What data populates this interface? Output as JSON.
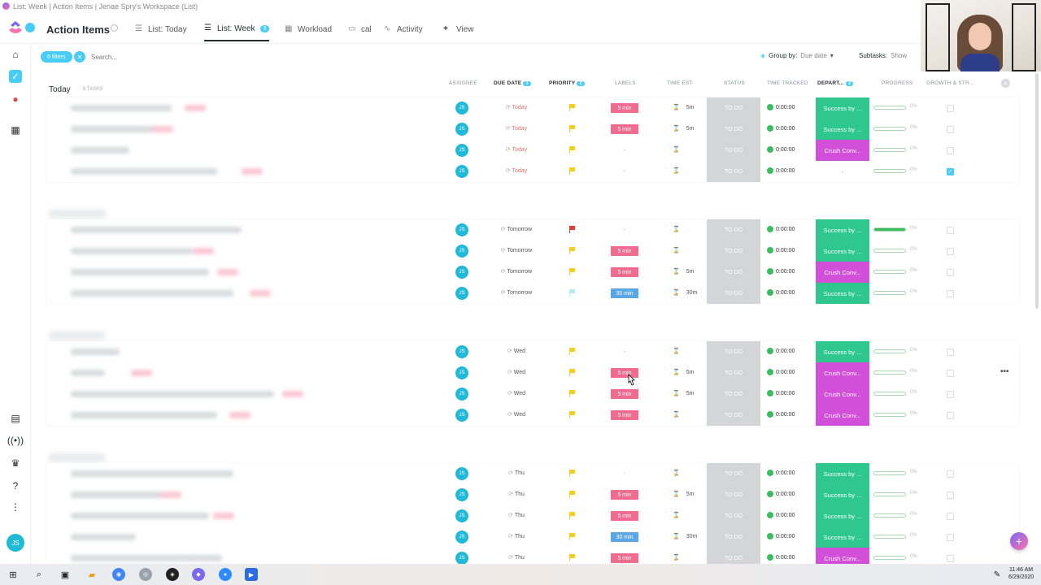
{
  "window_title": "List: Week | Action Items | Jenae Spry's Workspace (List)",
  "header": {
    "space_title": "Action Items",
    "tabs": [
      {
        "label": "List: Today",
        "icon": "list-icon"
      },
      {
        "label": "List: Week",
        "icon": "list-icon",
        "badge": "3"
      },
      {
        "label": "Workload",
        "icon": "grid-icon"
      },
      {
        "label": "cal",
        "icon": "calendar-icon"
      },
      {
        "label": "Activity",
        "icon": "activity-icon"
      },
      {
        "label": "View",
        "icon": "plus-icon"
      }
    ]
  },
  "toolbar": {
    "filters_label": "6 filters",
    "search_placeholder": "Search...",
    "group_by_label": "Group by:",
    "group_by_value": "Due date",
    "subtasks_label": "Subtasks:",
    "subtasks_value": "Show"
  },
  "columns": {
    "assignee": "ASSIGNEE",
    "due_date": "DUE DATE",
    "due_date_badge": "1",
    "priority": "PRIORITY",
    "priority_badge": "2",
    "labels": "LABELS",
    "time_est": "TIME EST.",
    "status": "STATUS",
    "time_tracked": "TIME TRACKED",
    "department": "DEPART...",
    "department_badge": "3",
    "progress": "PROGRESS",
    "growth": "GROWTH & STR..."
  },
  "groups": [
    {
      "title": "Today",
      "count": "6 TASKS",
      "rows": [
        {
          "due": "Today",
          "flag": "#f5cf19",
          "label": "5 min",
          "label_color": "#f06b8e",
          "est": "5m",
          "dept": "Success by ...",
          "dept_color": "#2ec78d",
          "progress": 0,
          "pct": "0%",
          "checked": false
        },
        {
          "due": "Today",
          "flag": "#f5cf19",
          "label": "5 min",
          "label_color": "#f06b8e",
          "est": "5m",
          "dept": "Success by ...",
          "dept_color": "#2ec78d",
          "progress": 0,
          "pct": "0%",
          "checked": false
        },
        {
          "due": "Today",
          "flag": "#f5cf19",
          "label": "-",
          "label_color": "",
          "est": "",
          "dept": "Crush Conv...",
          "dept_color": "#d24fd9",
          "progress": 0,
          "pct": "0%",
          "checked": false
        },
        {
          "due": "Today",
          "flag": "#f5cf19",
          "label": "-",
          "label_color": "",
          "est": "",
          "dept": "-",
          "dept_color": "",
          "progress": 0,
          "pct": "0%",
          "checked": true
        }
      ]
    },
    {
      "title": "",
      "count": "",
      "rows": [
        {
          "due": "Tomorrow",
          "flag": "#e53935",
          "label": "-",
          "label_color": "",
          "est": "",
          "dept": "Success by ...",
          "dept_color": "#2ec78d",
          "progress": 100,
          "pct": "0%",
          "checked": false
        },
        {
          "due": "Tomorrow",
          "flag": "#f5cf19",
          "label": "5 min",
          "label_color": "#f06b8e",
          "est": "",
          "dept": "Success by ...",
          "dept_color": "#2ec78d",
          "progress": 0,
          "pct": "0%",
          "checked": false
        },
        {
          "due": "Tomorrow",
          "flag": "#f5cf19",
          "label": "5 min",
          "label_color": "#f06b8e",
          "est": "5m",
          "dept": "Crush Conv...",
          "dept_color": "#d24fd9",
          "progress": 0,
          "pct": "0%",
          "checked": false
        },
        {
          "due": "Tomorrow",
          "flag": "#b9e8f5",
          "label": "30 min",
          "label_color": "#5aa7e8",
          "est": "30m",
          "dept": "Success by ...",
          "dept_color": "#2ec78d",
          "progress": 0,
          "pct": "0%",
          "checked": false
        }
      ]
    },
    {
      "title": "",
      "count": "",
      "rows": [
        {
          "due": "Wed",
          "flag": "#f5cf19",
          "label": "-",
          "label_color": "",
          "est": "",
          "dept": "Success by ...",
          "dept_color": "#2ec78d",
          "progress": 0,
          "pct": "0%",
          "checked": false
        },
        {
          "due": "Wed",
          "flag": "#f5cf19",
          "label": "5 min",
          "label_color": "#f06b8e",
          "est": "5m",
          "dept": "Crush Conv...",
          "dept_color": "#d24fd9",
          "progress": 0,
          "pct": "0%",
          "checked": false,
          "more": "•••"
        },
        {
          "due": "Wed",
          "flag": "#f5cf19",
          "label": "5 min",
          "label_color": "#f06b8e",
          "est": "5m",
          "dept": "Crush Conv...",
          "dept_color": "#d24fd9",
          "progress": 0,
          "pct": "0%",
          "checked": false
        },
        {
          "due": "Wed",
          "flag": "#f5cf19",
          "label": "5 min",
          "label_color": "#f06b8e",
          "est": "",
          "dept": "Crush Conv...",
          "dept_color": "#d24fd9",
          "progress": 0,
          "pct": "0%",
          "checked": false
        }
      ]
    },
    {
      "title": "",
      "count": "",
      "rows": [
        {
          "due": "Thu",
          "flag": "#f5cf19",
          "label": "-",
          "label_color": "",
          "est": "",
          "dept": "Success by ...",
          "dept_color": "#2ec78d",
          "progress": 0,
          "pct": "0%",
          "checked": false
        },
        {
          "due": "Thu",
          "flag": "#f5cf19",
          "label": "5 min",
          "label_color": "#f06b8e",
          "est": "5m",
          "dept": "Success by ...",
          "dept_color": "#2ec78d",
          "progress": 0,
          "pct": "0%",
          "checked": false
        },
        {
          "due": "Thu",
          "flag": "#f5cf19",
          "label": "5 min",
          "label_color": "#f06b8e",
          "est": "",
          "dept": "Success by ...",
          "dept_color": "#2ec78d",
          "progress": 0,
          "pct": "0%",
          "checked": false
        },
        {
          "due": "Thu",
          "flag": "#f5cf19",
          "label": "30 min",
          "label_color": "#5aa7e8",
          "est": "30m",
          "dept": "Success by ...",
          "dept_color": "#2ec78d",
          "progress": 0,
          "pct": "0%",
          "checked": false
        },
        {
          "due": "Thu",
          "flag": "#f5cf19",
          "label": "5 min",
          "label_color": "#f06b8e",
          "est": "",
          "dept": "Crush Conv...",
          "dept_color": "#d24fd9",
          "progress": 0,
          "pct": "0%",
          "checked": false
        }
      ]
    }
  ],
  "row_common": {
    "assignee_initials": "JS",
    "status": "TO DO",
    "tracked": "0:00:00"
  },
  "sidebar": {
    "icons": [
      "home-icon",
      "tasks-icon",
      "notifications-icon",
      "dashboards-icon",
      "docs-icon",
      "pulse-icon",
      "goals-icon",
      "help-icon",
      "more-icon"
    ],
    "avatar_initials": "JS"
  },
  "taskbar": {
    "time": "11:46 AM",
    "date": "6/29/2020"
  },
  "colors": {
    "accent": "#49ccf9",
    "status_todo": "#d3d5d9",
    "tracked_green": "#3dbb5f",
    "dept_success": "#2ec78d",
    "dept_crush": "#d24fd9"
  }
}
